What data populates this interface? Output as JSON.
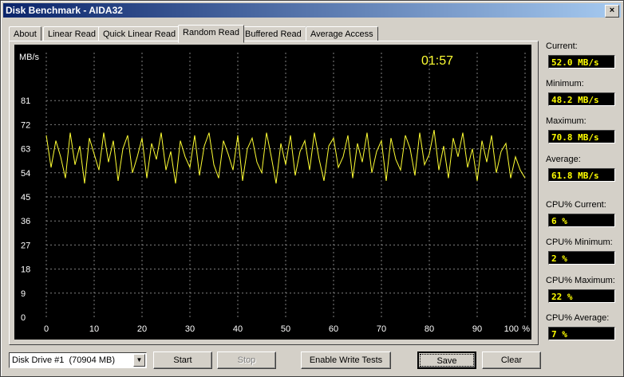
{
  "window": {
    "title": "Disk Benchmark - AIDA32",
    "close_glyph": "×"
  },
  "tabs": [
    {
      "label": "About",
      "active": false
    },
    {
      "label": "Linear Read",
      "active": false
    },
    {
      "label": "Quick Linear Read",
      "active": false
    },
    {
      "label": "Random Read",
      "active": true
    },
    {
      "label": "Buffered Read",
      "active": false
    },
    {
      "label": "Average Access",
      "active": false
    }
  ],
  "chart": {
    "timer": "01:57",
    "y_unit_label": "MB/s",
    "x_unit_label": "%",
    "line_color": "#ffff33",
    "grid_color": "#808080",
    "timer_color": "#ffff33"
  },
  "chart_data": {
    "type": "line",
    "ylabel": "MB/s",
    "xlabel": "%",
    "ylim": [
      0,
      90
    ],
    "xlim": [
      0,
      100
    ],
    "yticks": [
      "81",
      "72",
      "63",
      "54",
      "45",
      "36",
      "27",
      "18",
      "9",
      "0"
    ],
    "xticks": [
      "0",
      "10",
      "20",
      "30",
      "40",
      "50",
      "60",
      "70",
      "80",
      "90",
      "100"
    ],
    "grid": true,
    "series": [
      {
        "x": [
          0,
          1,
          2,
          3,
          4,
          5,
          6,
          7,
          8,
          9,
          10,
          11,
          12,
          13,
          14,
          15,
          16,
          17,
          18,
          19,
          20,
          21,
          22,
          23,
          24,
          25,
          26,
          27,
          28,
          29,
          30,
          31,
          32,
          33,
          34,
          35,
          36,
          37,
          38,
          39,
          40,
          41,
          42,
          43,
          44,
          45,
          46,
          47,
          48,
          49,
          50,
          51,
          52,
          53,
          54,
          55,
          56,
          57,
          58,
          59,
          60,
          61,
          62,
          63,
          64,
          65,
          66,
          67,
          68,
          69,
          70,
          71,
          72,
          73,
          74,
          75,
          76,
          77,
          78,
          79,
          80,
          81,
          82,
          83,
          84,
          85,
          86,
          87,
          88,
          89,
          90,
          91,
          92,
          93,
          94,
          95,
          96,
          97,
          98,
          99,
          100
        ],
        "y": [
          68,
          56,
          66,
          60,
          52,
          69,
          57,
          64,
          50,
          67,
          61,
          55,
          69,
          58,
          66,
          51,
          63,
          68,
          54,
          60,
          67,
          52,
          65,
          59,
          69,
          55,
          62,
          50,
          66,
          60,
          56,
          68,
          53,
          64,
          69,
          57,
          52,
          66,
          61,
          55,
          68,
          51,
          63,
          67,
          58,
          54,
          69,
          60,
          50,
          65,
          57,
          68,
          53,
          62,
          66,
          55,
          69,
          59,
          51,
          64,
          67,
          56,
          60,
          68,
          52,
          65,
          58,
          69,
          54,
          62,
          66,
          51,
          67,
          59,
          55,
          68,
          63,
          53,
          69,
          57,
          61,
          70,
          55,
          64,
          52,
          67,
          60,
          69,
          56,
          63,
          51,
          66,
          58,
          68,
          54,
          62,
          65,
          52,
          60,
          55,
          52
        ]
      }
    ]
  },
  "stats": [
    {
      "label": "Current:",
      "value": "52.0 MB/s"
    },
    {
      "label": "Minimum:",
      "value": "48.2 MB/s"
    },
    {
      "label": "Maximum:",
      "value": "70.8 MB/s"
    },
    {
      "label": "Average:",
      "value": "61.8 MB/s"
    },
    {
      "label": "CPU% Current:",
      "value": "6 %"
    },
    {
      "label": "CPU% Minimum:",
      "value": "2 %"
    },
    {
      "label": "CPU% Maximum:",
      "value": "22 %"
    },
    {
      "label": "CPU% Average:",
      "value": "7 %"
    }
  ],
  "controls": {
    "drive_select": "Disk Drive #1  (70904 MB)",
    "start_label": "Start",
    "stop_label": "Stop",
    "enable_write_label": "Enable Write Tests",
    "save_label": "Save",
    "clear_label": "Clear"
  }
}
